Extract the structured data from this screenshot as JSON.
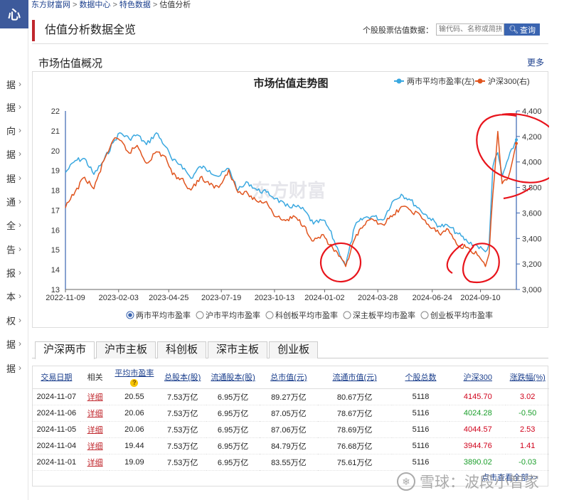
{
  "sidebar": {
    "logo": "心",
    "items": [
      "据",
      "据",
      "向",
      "据",
      "据",
      "通",
      "全",
      "告",
      "报",
      "本",
      "权",
      "据",
      "据"
    ]
  },
  "breadcrumb": [
    "东方财富网",
    "数据中心",
    "特色数据",
    "估值分析"
  ],
  "header": {
    "title": "估值分析数据全览",
    "search_label": "个股股票估值数据：",
    "search_placeholder": "输代码、名称或简拼",
    "search_button": "查询"
  },
  "overview": {
    "title": "市场估值概况",
    "more": "更多"
  },
  "chart_data": {
    "type": "line",
    "title": "市场估值走势图",
    "legend_placement": "top-right",
    "grid": false,
    "watermark": "东方财富",
    "x_ticks": [
      "2022-11-09",
      "2023-02-03",
      "2023-04-25",
      "2023-07-19",
      "2023-10-13",
      "2024-01-02",
      "2024-03-28",
      "2024-06-24",
      "2024-09-10"
    ],
    "x_range": [
      "2022-11-09",
      "2024-11-07"
    ],
    "y_left": {
      "ticks": [
        "22",
        "21",
        "20",
        "19",
        "18",
        "17",
        "16",
        "15",
        "14",
        "13"
      ],
      "range": [
        13,
        22
      ]
    },
    "y_right": {
      "ticks": [
        "4,400",
        "4,200",
        "4,000",
        "3,800",
        "3,600",
        "3,400",
        "3,200",
        "3,000"
      ],
      "range": [
        3000,
        4400
      ]
    },
    "series": [
      {
        "name": "两市平均市盈率(左)",
        "axis": "left",
        "color": "#3aa8e0",
        "points": [
          [
            "2022-11-09",
            18.9
          ],
          [
            "2022-11-25",
            19.5
          ],
          [
            "2022-12-10",
            19.6
          ],
          [
            "2022-12-25",
            18.8
          ],
          [
            "2023-01-10",
            19.5
          ],
          [
            "2023-01-25",
            20.4
          ],
          [
            "2023-02-05",
            20.9
          ],
          [
            "2023-02-20",
            20.6
          ],
          [
            "2023-03-05",
            20.8
          ],
          [
            "2023-03-20",
            20.3
          ],
          [
            "2023-04-05",
            20.9
          ],
          [
            "2023-04-20",
            20.2
          ],
          [
            "2023-05-01",
            19.5
          ],
          [
            "2023-05-15",
            19.3
          ],
          [
            "2023-05-31",
            18.6
          ],
          [
            "2023-06-15",
            19.2
          ],
          [
            "2023-06-30",
            19.0
          ],
          [
            "2023-07-15",
            18.7
          ],
          [
            "2023-07-31",
            19.1
          ],
          [
            "2023-08-15",
            18.0
          ],
          [
            "2023-08-31",
            18.4
          ],
          [
            "2023-09-15",
            18.0
          ],
          [
            "2023-09-30",
            17.9
          ],
          [
            "2023-10-15",
            17.6
          ],
          [
            "2023-10-31",
            17.2
          ],
          [
            "2023-11-15",
            17.2
          ],
          [
            "2023-11-30",
            17.0
          ],
          [
            "2023-12-15",
            16.3
          ],
          [
            "2023-12-31",
            16.5
          ],
          [
            "2024-01-10",
            16.0
          ],
          [
            "2024-01-25",
            14.9
          ],
          [
            "2024-02-05",
            14.2
          ],
          [
            "2024-02-20",
            16.2
          ],
          [
            "2024-03-05",
            16.6
          ],
          [
            "2024-03-20",
            16.7
          ],
          [
            "2024-04-05",
            16.5
          ],
          [
            "2024-04-20",
            17.4
          ],
          [
            "2024-05-05",
            17.8
          ],
          [
            "2024-05-20",
            17.5
          ],
          [
            "2024-06-05",
            17.0
          ],
          [
            "2024-06-20",
            16.6
          ],
          [
            "2024-07-05",
            16.2
          ],
          [
            "2024-07-20",
            16.2
          ],
          [
            "2024-08-05",
            15.8
          ],
          [
            "2024-08-20",
            15.4
          ],
          [
            "2024-09-05",
            15.2
          ],
          [
            "2024-09-18",
            14.9
          ],
          [
            "2024-09-24",
            15.3
          ],
          [
            "2024-09-30",
            19.2
          ],
          [
            "2024-10-08",
            19.9
          ],
          [
            "2024-10-15",
            18.7
          ],
          [
            "2024-10-25",
            19.6
          ],
          [
            "2024-11-07",
            20.55
          ]
        ]
      },
      {
        "name": "沪深300(右)",
        "axis": "right",
        "color": "#e0541e",
        "points": [
          [
            "2022-11-09",
            3640
          ],
          [
            "2022-11-25",
            3770
          ],
          [
            "2022-12-10",
            3880
          ],
          [
            "2022-12-25",
            3790
          ],
          [
            "2023-01-10",
            4010
          ],
          [
            "2023-01-25",
            4170
          ],
          [
            "2023-02-05",
            4170
          ],
          [
            "2023-02-20",
            4070
          ],
          [
            "2023-03-05",
            4130
          ],
          [
            "2023-03-20",
            3990
          ],
          [
            "2023-04-05",
            4080
          ],
          [
            "2023-04-20",
            4040
          ],
          [
            "2023-05-01",
            3900
          ],
          [
            "2023-05-15",
            3870
          ],
          [
            "2023-05-31",
            3780
          ],
          [
            "2023-06-15",
            3880
          ],
          [
            "2023-06-30",
            3820
          ],
          [
            "2023-07-15",
            3800
          ],
          [
            "2023-07-31",
            3940
          ],
          [
            "2023-08-15",
            3760
          ],
          [
            "2023-08-31",
            3750
          ],
          [
            "2023-09-15",
            3690
          ],
          [
            "2023-09-30",
            3690
          ],
          [
            "2023-10-15",
            3570
          ],
          [
            "2023-10-31",
            3540
          ],
          [
            "2023-11-15",
            3570
          ],
          [
            "2023-11-30",
            3500
          ],
          [
            "2023-12-15",
            3380
          ],
          [
            "2023-12-31",
            3430
          ],
          [
            "2024-01-10",
            3350
          ],
          [
            "2024-01-25",
            3260
          ],
          [
            "2024-02-05",
            3180
          ],
          [
            "2024-02-20",
            3400
          ],
          [
            "2024-03-05",
            3500
          ],
          [
            "2024-03-20",
            3550
          ],
          [
            "2024-04-05",
            3510
          ],
          [
            "2024-04-20",
            3570
          ],
          [
            "2024-05-05",
            3650
          ],
          [
            "2024-05-20",
            3620
          ],
          [
            "2024-06-05",
            3580
          ],
          [
            "2024-06-20",
            3490
          ],
          [
            "2024-07-05",
            3440
          ],
          [
            "2024-07-20",
            3470
          ],
          [
            "2024-08-05",
            3340
          ],
          [
            "2024-08-20",
            3330
          ],
          [
            "2024-09-05",
            3270
          ],
          [
            "2024-09-18",
            3180
          ],
          [
            "2024-09-24",
            3280
          ],
          [
            "2024-09-30",
            3750
          ],
          [
            "2024-10-08",
            4240
          ],
          [
            "2024-10-15",
            3830
          ],
          [
            "2024-10-25",
            3880
          ],
          [
            "2024-11-07",
            4145.7
          ]
        ]
      }
    ],
    "annotations": [
      "hand-drawn red circles around 2024-01 low, 2024-09 low and 2024-10 peak"
    ]
  },
  "chart_radio": {
    "selected": 0,
    "options": [
      "两市平均市盈率",
      "沪市平均市盈率",
      "科创板平均市盈率",
      "深主板平均市盈率",
      "创业板平均市盈率"
    ]
  },
  "tabs": [
    "沪深两市",
    "沪市主板",
    "科创板",
    "深市主板",
    "创业板"
  ],
  "table": {
    "headers": [
      "交易日期",
      "相关",
      "平均市盈率",
      "总股本(股)",
      "流通股本(股)",
      "总市值(元)",
      "流通市值(元)",
      "个股总数",
      "沪深300",
      "涨跌幅(%)"
    ],
    "help_icon": "?",
    "rows": [
      {
        "date": "2024-11-07",
        "link": "详细",
        "pe": "20.55",
        "shares": "7.53万亿",
        "float": "6.95万亿",
        "cap": "89.27万亿",
        "float_cap": "80.67万亿",
        "count": "5118",
        "hs300": "4145.70",
        "chg": "3.02",
        "dir": "up"
      },
      {
        "date": "2024-11-06",
        "link": "详细",
        "pe": "20.06",
        "shares": "7.53万亿",
        "float": "6.95万亿",
        "cap": "87.05万亿",
        "float_cap": "78.67万亿",
        "count": "5116",
        "hs300": "4024.28",
        "chg": "-0.50",
        "dir": "down"
      },
      {
        "date": "2024-11-05",
        "link": "详细",
        "pe": "20.06",
        "shares": "7.53万亿",
        "float": "6.95万亿",
        "cap": "87.06万亿",
        "float_cap": "78.69万亿",
        "count": "5116",
        "hs300": "4044.57",
        "chg": "2.53",
        "dir": "up"
      },
      {
        "date": "2024-11-04",
        "link": "详细",
        "pe": "19.44",
        "shares": "7.53万亿",
        "float": "6.95万亿",
        "cap": "84.79万亿",
        "float_cap": "76.68万亿",
        "count": "5116",
        "hs300": "3944.76",
        "chg": "1.41",
        "dir": "up"
      },
      {
        "date": "2024-11-01",
        "link": "详细",
        "pe": "19.09",
        "shares": "7.53万亿",
        "float": "6.95万亿",
        "cap": "83.55万亿",
        "float_cap": "75.61万亿",
        "count": "5116",
        "hs300": "3890.02",
        "chg": "-0.03",
        "dir": "down"
      }
    ],
    "more": "点击查看全部>>"
  },
  "watermark": "雪球：波段小智家"
}
